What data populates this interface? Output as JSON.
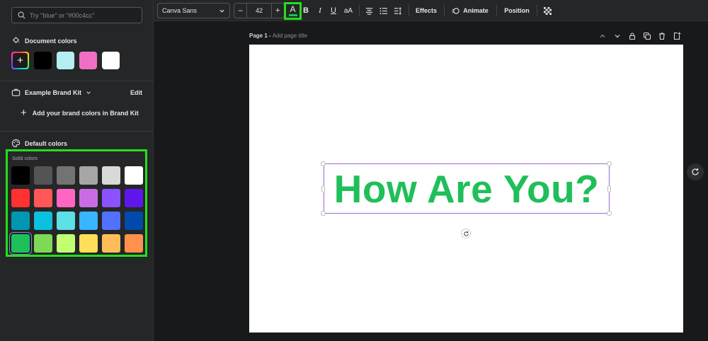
{
  "search": {
    "placeholder": "Try \"blue\" or \"#00c4cc\""
  },
  "document_colors": {
    "title": "Document colors",
    "swatches": [
      "#000000",
      "#b4eef2",
      "#f06fc4",
      "#ffffff"
    ]
  },
  "brand_kit": {
    "name": "Example Brand Kit",
    "edit_label": "Edit",
    "add_label": "Add your brand colors in Brand Kit"
  },
  "default_colors": {
    "title": "Default colors",
    "solid_label": "Solid colors",
    "selected_color": "#1fbf59",
    "solid_colors": [
      "#000000",
      "#545454",
      "#737373",
      "#a6a6a6",
      "#d9d9d9",
      "#ffffff",
      "#ff3131",
      "#ff5757",
      "#ff66c4",
      "#cb6ce6",
      "#8c52ff",
      "#5e17eb",
      "#0097b2",
      "#0cc0df",
      "#5ce1e6",
      "#38b6ff",
      "#5271ff",
      "#004aad",
      "#1fbf59",
      "#7ed957",
      "#c1ff72",
      "#ffde59",
      "#ffbd59",
      "#ff914d"
    ]
  },
  "toolbar": {
    "font": "Canva Sans",
    "font_size": "42",
    "minus": "–",
    "plus": "+",
    "text_color_letter": "A",
    "bold": "B",
    "italic": "I",
    "underline": "U",
    "case": "aA",
    "effects": "Effects",
    "animate": "Animate",
    "position": "Position"
  },
  "page": {
    "label": "Page 1 - ",
    "title_placeholder": "Add page title",
    "text": "How Are You?"
  }
}
